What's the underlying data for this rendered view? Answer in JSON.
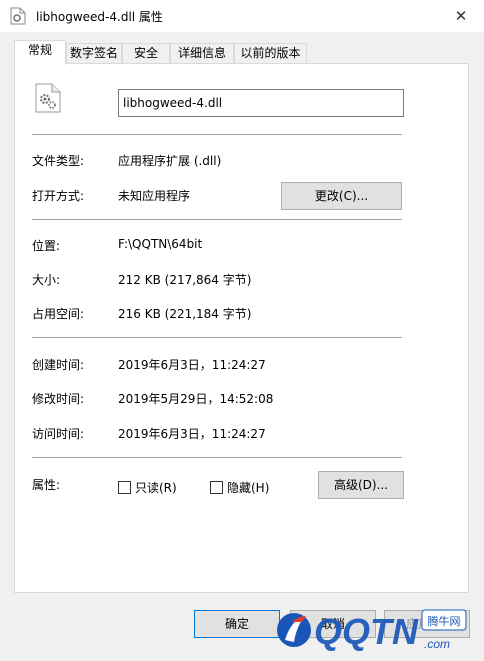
{
  "window": {
    "title": "libhogweed-4.dll 属性",
    "close_glyph": "✕"
  },
  "tabs": [
    {
      "label": "常规",
      "active": true
    },
    {
      "label": "数字签名",
      "active": false
    },
    {
      "label": "安全",
      "active": false
    },
    {
      "label": "详细信息",
      "active": false
    },
    {
      "label": "以前的版本",
      "active": false
    }
  ],
  "general": {
    "file_name": "libhogweed-4.dll",
    "rows": {
      "file_type": {
        "label": "文件类型:",
        "value": "应用程序扩展 (.dll)"
      },
      "opens_with": {
        "label": "打开方式:",
        "value": "未知应用程序",
        "change_button": "更改(C)..."
      },
      "location": {
        "label": "位置:",
        "value": "F:\\QQTN\\64bit"
      },
      "size": {
        "label": "大小:",
        "value": "212 KB (217,864 字节)"
      },
      "size_on_disk": {
        "label": "占用空间:",
        "value": "216 KB (221,184 字节)"
      },
      "created": {
        "label": "创建时间:",
        "value": "2019年6月3日，11:24:27"
      },
      "modified": {
        "label": "修改时间:",
        "value": "2019年5月29日，14:52:08"
      },
      "accessed": {
        "label": "访问时间:",
        "value": "2019年6月3日，11:24:27"
      }
    },
    "attributes": {
      "label": "属性:",
      "readonly": {
        "label": "只读(R)",
        "checked": false
      },
      "hidden": {
        "label": "隐藏(H)",
        "checked": false
      },
      "advanced_button": "高级(D)..."
    }
  },
  "footer": {
    "ok": "确定",
    "cancel": "取消",
    "apply": "应用(A)"
  },
  "watermark": {
    "text": "QQTN",
    "suffix": ".com",
    "badge": "腾牛网"
  },
  "colors": {
    "accent": "#0078d7",
    "watermark_blue": "#1a56b8",
    "watermark_red": "#e23a2e"
  }
}
